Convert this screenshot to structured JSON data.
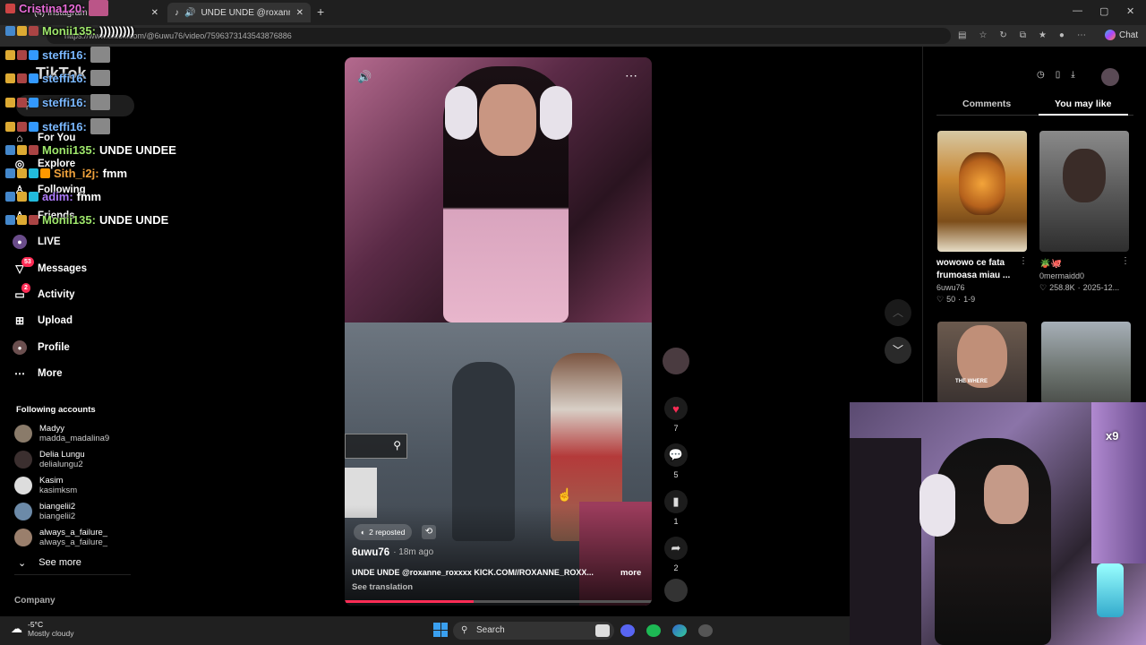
{
  "browser": {
    "tabs": [
      {
        "label": "(4) Instagram"
      },
      {
        "label": "UNDE UNDE @roxanne_roxxx"
      }
    ],
    "url": "https://www.tiktok.com/@6uwu76/video/7596373143543876886",
    "chat_button": "Chat"
  },
  "sidebar": {
    "logo": "TikTok",
    "nav": [
      {
        "label": "For You",
        "icon": "home-icon"
      },
      {
        "label": "Explore",
        "icon": "compass-icon"
      },
      {
        "label": "Following",
        "icon": "following-icon"
      },
      {
        "label": "Friends",
        "icon": "friends-icon"
      },
      {
        "label": "LIVE",
        "icon": "live-icon"
      },
      {
        "label": "Messages",
        "icon": "message-icon",
        "badge": "53"
      },
      {
        "label": "Activity",
        "icon": "activity-icon",
        "badge": "2"
      },
      {
        "label": "Upload",
        "icon": "upload-icon"
      },
      {
        "label": "Profile",
        "icon": "profile-icon"
      },
      {
        "label": "More",
        "icon": "more-icon"
      }
    ],
    "following_header": "Following accounts",
    "accounts": [
      {
        "name": "Madyy",
        "handle": "madda_madalina9"
      },
      {
        "name": "Delia Lungu",
        "handle": "delialungu2"
      },
      {
        "name": "Kasim",
        "handle": "kasimksm"
      },
      {
        "name": "biangelii2",
        "handle": "biangelii2"
      },
      {
        "name": "always_a_failure_",
        "handle": "always_a_failure_"
      }
    ],
    "see_more": "See more",
    "company": "Company"
  },
  "chat": [
    {
      "user": "Cristina120:",
      "msg": "",
      "color": "#e86bd8"
    },
    {
      "user": "Monii135:",
      "msg": ")))))))))",
      "color": "#9ee66b"
    },
    {
      "user": "steffi16:",
      "msg": "",
      "color": "#7ab8ff"
    },
    {
      "user": "steffi16:",
      "msg": "",
      "color": "#7ab8ff"
    },
    {
      "user": "steffi16:",
      "msg": "",
      "color": "#7ab8ff"
    },
    {
      "user": "steffi16:",
      "msg": "",
      "color": "#7ab8ff"
    },
    {
      "user": "Monii135:",
      "msg": "UNDE UNDEE",
      "color": "#9ee66b"
    },
    {
      "user": "Sith_i2j:",
      "msg": "fmm",
      "color": "#f0a23c"
    },
    {
      "user": "adim:",
      "msg": "fmm",
      "color": "#b07cff"
    },
    {
      "user": "Monii135:",
      "msg": "UNDE UNDE",
      "color": "#9ee66b"
    }
  ],
  "video": {
    "reposted": "2 reposted",
    "author": "6uwu76",
    "time": "· 18m ago",
    "caption": "UNDE UNDE @roxanne_roxxxx  KICK.COM//ROXANNE_ROXX...",
    "more": "more",
    "see_translation": "See translation",
    "progress": 0.42
  },
  "actions": {
    "likes": "7",
    "comments": "5",
    "saves": "1",
    "shares": "2"
  },
  "right_panel": {
    "tabs": [
      "Comments",
      "You may like"
    ],
    "active_tab": "You may like",
    "recommendations": [
      {
        "title": "wowowo ce fata frumoasa miau ...",
        "author": "6uwu76",
        "likes": "50",
        "date": "1-9"
      },
      {
        "title": "",
        "author": "0mermaidd0",
        "likes": "258.8K",
        "date": "2025-12..."
      },
      {
        "title": "",
        "author": "",
        "likes": "",
        "date": "",
        "overlay": "THE WHERE"
      },
      {
        "title": "",
        "author": "",
        "likes": "",
        "date": ""
      }
    ]
  },
  "overlay": {
    "multiplier": "x9"
  },
  "taskbar": {
    "weather_temp": "-5°C",
    "weather_desc": "Mostly cloudy",
    "search": "Search"
  }
}
